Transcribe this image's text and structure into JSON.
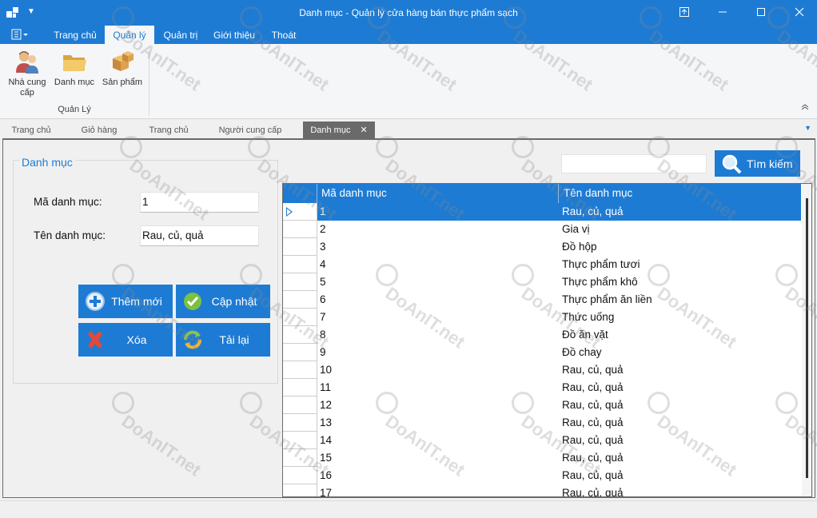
{
  "window": {
    "title": "Danh mục - Quản lý cửa hàng bán thực phẩm sạch"
  },
  "ribbon": {
    "tabs": [
      {
        "label": "Trang chủ",
        "active": false
      },
      {
        "label": "Quản lý",
        "active": true
      },
      {
        "label": "Quản trị",
        "active": false
      },
      {
        "label": "Giới thiệu",
        "active": false
      },
      {
        "label": "Thoát",
        "active": false
      }
    ],
    "buttons": [
      {
        "label": "Nhà cung cấp",
        "icon": "users-icon"
      },
      {
        "label": "Danh mục",
        "icon": "folder-icon"
      },
      {
        "label": "Sản phẩm",
        "icon": "boxes-icon"
      }
    ],
    "group_label": "Quản Lý"
  },
  "doc_tabs": [
    {
      "label": "Trang chủ",
      "active": false
    },
    {
      "label": "Giỏ hàng",
      "active": false
    },
    {
      "label": "Trang chủ",
      "active": false
    },
    {
      "label": "Người cung cấp",
      "active": false
    },
    {
      "label": "Danh mục",
      "active": true,
      "close": "✕"
    }
  ],
  "form": {
    "group_title": "Danh mục",
    "id_label": "Mã danh mục:",
    "id_value": "1",
    "name_label": "Tên danh mục:",
    "name_value": "Rau, củ, quả",
    "buttons": {
      "add": "Thêm mới",
      "update": "Cập nhật",
      "delete": "Xóa",
      "reload": "Tải lại"
    }
  },
  "search": {
    "value": "",
    "button_label": "Tìm kiếm"
  },
  "grid": {
    "columns": [
      "Mã danh mục",
      "Tên danh mục"
    ],
    "selected_index": 0,
    "rows": [
      [
        "1",
        "Rau, củ, quả"
      ],
      [
        "2",
        "Gia vị"
      ],
      [
        "3",
        "Đồ hộp"
      ],
      [
        "4",
        "Thực phẩm tươi"
      ],
      [
        "5",
        "Thực phẩm khô"
      ],
      [
        "6",
        "Thực phẩm ăn liền"
      ],
      [
        "7",
        "Thức uống"
      ],
      [
        "8",
        "Đồ ăn vặt"
      ],
      [
        "9",
        "Đồ chay"
      ],
      [
        "10",
        "Rau, củ, quả"
      ],
      [
        "11",
        "Rau, củ, quả"
      ],
      [
        "12",
        "Rau, củ, quả"
      ],
      [
        "13",
        "Rau, củ, quả"
      ],
      [
        "14",
        "Rau, củ, quả"
      ],
      [
        "15",
        "Rau, củ, quả"
      ],
      [
        "16",
        "Rau, củ, quả"
      ],
      [
        "17",
        "Rau, củ, quả"
      ]
    ]
  },
  "watermark": "DoAnIT.net",
  "colors": {
    "accent": "#1d7bd4",
    "tab_active": "#6a6a6a"
  }
}
